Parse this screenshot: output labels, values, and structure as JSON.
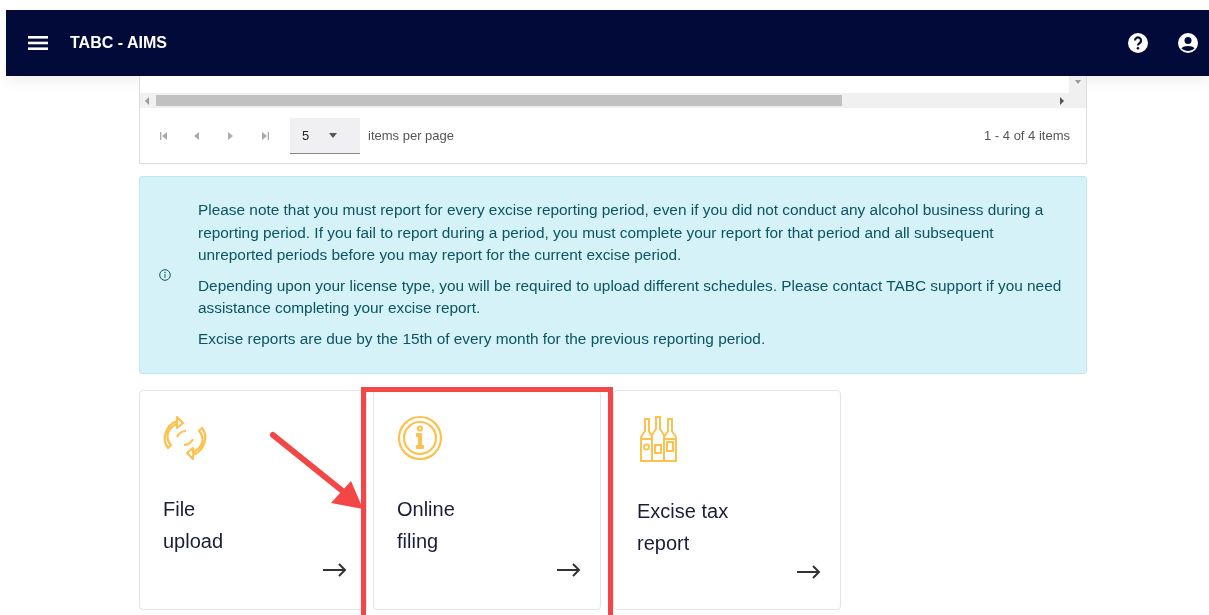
{
  "app_bar": {
    "title": "TABC - AIMS"
  },
  "pager": {
    "page_size": "5",
    "items_per_page_label": "items per page",
    "range": "1 - 4 of 4 items"
  },
  "notice": {
    "paragraphs": [
      "Please note that you must report for every excise reporting period, even if you did not conduct any alcohol business during a reporting period. If you fail to report during a period, you must complete your report for that period and all subsequent unreported periods before you may report for the current excise period.",
      "Depending upon your license type, you will be required to upload different schedules. Please contact TABC support if you need assistance completing your excise report.",
      "Excise reports are due by the 15th of every month for the previous reporting period."
    ]
  },
  "cards": [
    {
      "kind": "upload",
      "title_lines": [
        "File",
        "upload"
      ],
      "highlighted": false
    },
    {
      "kind": "info",
      "title_lines": [
        "Online",
        "filing"
      ],
      "highlighted": true
    },
    {
      "kind": "bottles",
      "title_lines": [
        "Excise tax",
        "report"
      ],
      "highlighted": false
    }
  ]
}
